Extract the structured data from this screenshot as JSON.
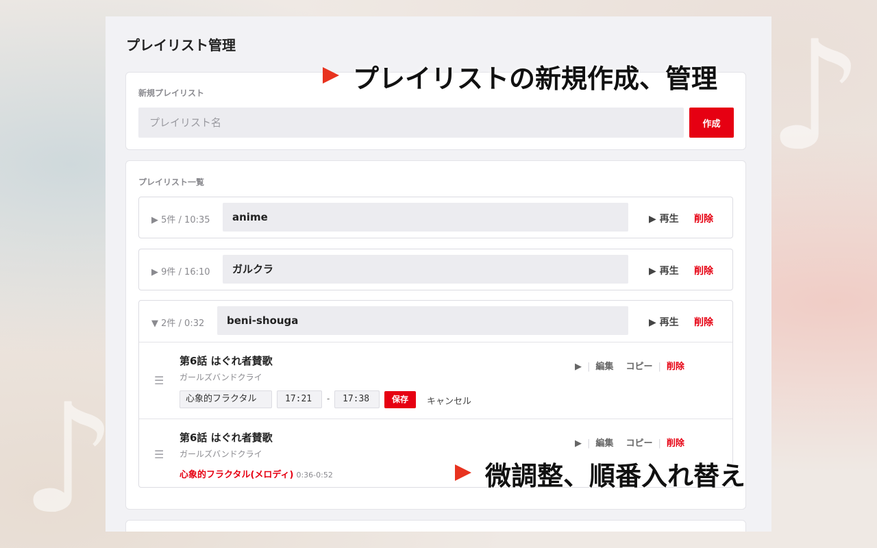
{
  "panel": {
    "title": "プレイリスト管理"
  },
  "new_playlist": {
    "label": "新規プレイリスト",
    "placeholder": "プレイリスト名",
    "create_label": "作成"
  },
  "list": {
    "label": "プレイリスト一覧",
    "playlists": [
      {
        "toggle": "▶",
        "meta": "5件 / 10:35",
        "name": "anime",
        "play": "▶ 再生",
        "delete": "削除"
      },
      {
        "toggle": "▶",
        "meta": "9件 / 16:10",
        "name": "ガルクラ",
        "play": "▶ 再生",
        "delete": "削除"
      },
      {
        "toggle": "▼",
        "meta": "2件 / 0:32",
        "name": "beni-shouga",
        "play": "▶ 再生",
        "delete": "削除"
      }
    ],
    "tracks": [
      {
        "handle": "☰",
        "title": "第6話 はぐれ者賛歌",
        "artist": "ガールズバンドクライ",
        "actions": {
          "play": "▶",
          "edit": "編集",
          "copy": "コピー",
          "delete": "削除"
        },
        "edit_form": {
          "segment_name": "心象的フラクタル",
          "start": "17:21",
          "dash": "-",
          "end": "17:38",
          "save": "保存",
          "cancel": "キャンセル"
        }
      },
      {
        "handle": "☰",
        "title": "第6話 はぐれ者賛歌",
        "artist": "ガールズバンドクライ",
        "actions": {
          "play": "▶",
          "edit": "編集",
          "copy": "コピー",
          "delete": "削除"
        },
        "segment": {
          "name": "心象的フラクタル(メロディ)",
          "range": "0:36-0:52"
        }
      }
    ]
  },
  "annotations": {
    "top": "プレイリストの新規作成、管理",
    "bottom": "微調整、順番入れ替え"
  },
  "colors": {
    "accent": "#e60012",
    "annotation_arrow": "#e8331f"
  }
}
